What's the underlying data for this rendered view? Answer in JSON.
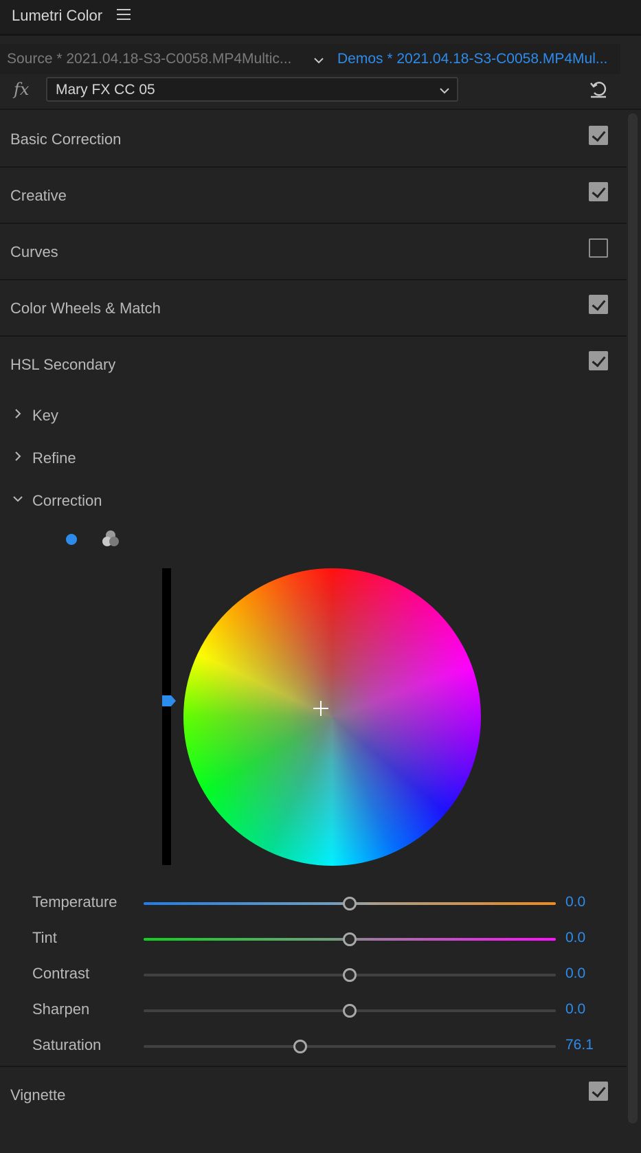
{
  "panel": {
    "title": "Lumetri Color"
  },
  "tabs": {
    "source": "Source * 2021.04.18-S3-C0058.MP4Multic...",
    "active": "Demos * 2021.04.18-S3-C0058.MP4Mul..."
  },
  "fx": {
    "icon_text": "fx",
    "preset": "Mary FX CC 05"
  },
  "sections": [
    {
      "label": "Basic Correction",
      "enabled": true
    },
    {
      "label": "Creative",
      "enabled": true
    },
    {
      "label": "Curves",
      "enabled": false
    },
    {
      "label": "Color Wheels & Match",
      "enabled": true
    },
    {
      "label": "HSL Secondary",
      "enabled": true
    }
  ],
  "hsl": {
    "subsections": [
      {
        "label": "Key",
        "expanded": false
      },
      {
        "label": "Refine",
        "expanded": false
      },
      {
        "label": "Correction",
        "expanded": true
      }
    ],
    "mode": "single-wheel",
    "sliders": [
      {
        "label": "Temperature",
        "value": "0.0",
        "position": 0.5
      },
      {
        "label": "Tint",
        "value": "0.0",
        "position": 0.5
      },
      {
        "label": "Contrast",
        "value": "0.0",
        "position": 0.5
      },
      {
        "label": "Sharpen",
        "value": "0.0",
        "position": 0.5
      },
      {
        "label": "Saturation",
        "value": "76.1",
        "position": 0.38
      }
    ]
  },
  "vignette": {
    "label": "Vignette",
    "enabled": true
  },
  "colors": {
    "accent": "#2d8ceb",
    "background": "#232323",
    "text": "#b9b9b9"
  }
}
